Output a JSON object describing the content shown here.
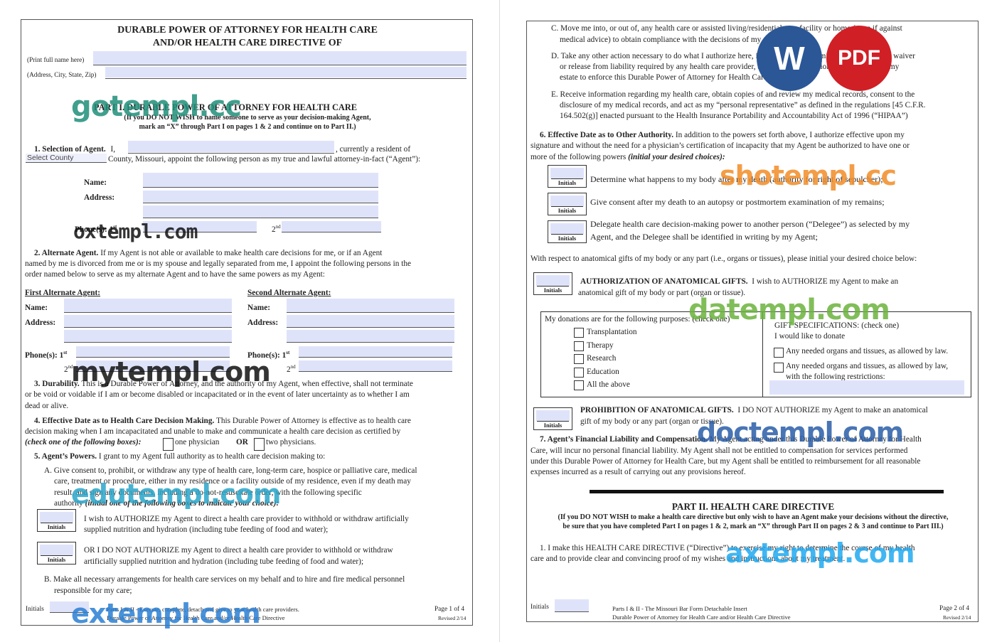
{
  "p1": {
    "title1": "DURABLE POWER OF ATTORNEY FOR HEALTH CARE",
    "title2": "AND/OR HEALTH CARE DIRECTIVE OF",
    "print_name": "(Print full name here)",
    "address_city": "(Address, City, State, Zip)",
    "part1_title": "PART I.   DURABLE POWER OF ATTORNEY FOR HEALTH CARE",
    "part1_sub1": "(If you DO NOT WISH to name someone to serve as your decision-making Agent,",
    "part1_sub2": "mark an “X” through Part I on pages 1 & 2 and continue on to Part II.)",
    "s1_head": "1. Selection of Agent.",
    "s1_i": "I,",
    "s1_resident": ", currently a resident of",
    "county_select": "Select County",
    "s1_county": "County, Missouri, appoint the following person as my true and lawful attorney-in-fact (“Agent”):",
    "name_label": "Name:",
    "address_label": "Address:",
    "phones_label": "Phone(s): 1",
    "second": "2",
    "st": "st",
    "nd": "nd",
    "s2_head": "2. Alternate Agent.",
    "s2_l1": "If my Agent is not able or available to make health care decisions for me, or if an Agent",
    "s2_l2": "named by me is divorced from me or is my spouse and legally separated from me, I appoint the following persons in the",
    "s2_l3": "order named below to serve as my alternate Agent and to have the same powers as my Agent:",
    "first_alt": "First Alternate Agent:",
    "second_alt": "Second Alternate Agent:",
    "s3_head": "3. Durability.",
    "s3_l1": "This is a Durable Power of Attorney, and the authority of my Agent, when effective, shall not terminate",
    "s3_l2": "or be void or voidable if I am or become disabled or incapacitated or in the event of later uncertainty as to whether I am",
    "s3_l3": "dead or alive.",
    "s4_head": "4. Effective Date as to Health Care Decision Making.",
    "s4_l1": "This Durable Power of Attorney is effective as to health care",
    "s4_l2": "decision making when I am incapacitated and unable to make and communicate a health care decision as certified by",
    "s4_check": "(check one of the following boxes):",
    "one_physician": "one physician",
    "or": "OR",
    "two_physicians": "two physicians.",
    "s5_head": "5. Agent’s Powers.",
    "s5_l1": "I grant to my Agent full authority as to health care decision making to:",
    "s5a_l1": "A.  Give consent to, prohibit, or withdraw any type of health care, long-term care, hospice or palliative care, medical",
    "s5a_l2": "care, treatment or procedure, either in my residence or a facility outside of my residence, even if my death may",
    "s5a_l3": "result, and sign any documents, including a do-not-resuscitate order, with the following specific",
    "s5a_l4a": "authority",
    "s5a_l4b": "(initial one of the following boxes to indicate your choice):",
    "authorize_l1": "I wish to AUTHORIZE my Agent to direct a health care provider to withhold or withdraw artificially",
    "authorize_l2": "supplied nutrition and hydration (including tube feeding of food and water);",
    "notauth_l1": "OR I DO NOT AUTHORIZE my Agent to direct a health care provider to withhold or withdraw",
    "notauth_l2": "artificially supplied nutrition and hydration (including tube feeding of food and water);",
    "s5b_l1": "B.  Make all necessary arrangements for health care services on my behalf and to hire and fire medical personnel",
    "s5b_l2": "responsible for my care;",
    "initials_label": "Initials",
    "footer_l1": "Parts I & II - Execute, complete, detach and give to your health care providers.",
    "footer_l2": "Durable Power of Attorney for Health Care and/or Health Care Directive",
    "page": "Page 1 of 4",
    "revised": "Revised 2/14"
  },
  "p2": {
    "c_l1": "C. Move me into, or out of, any health care or assisted living/residential care facility or home (even if against",
    "c_l2": "medical advice) to obtain compliance with the decisions of my Agent;",
    "d_l1": "D. Take any other action necessary to do what I authorize here, including (but not limited to) granting any waiver",
    "d_l2": "or release from liability required by any health care provider, and taking legal action at the expense of my",
    "d_l3": "estate to enforce this Durable Power of Attorney for Health Care;",
    "e_l1": "E.  Receive information regarding my health care, obtain copies of and review my medical records, consent to the",
    "e_l2": "disclosure of my medical records, and act as my “personal representative” as defined in the regulations [45 C.F.R.",
    "e_l3": "164.502(g)] enacted pursuant to the Health Insurance Portability and Accountability Act of 1996 (“HIPAA”)",
    "s6_head": "6. Effective Date as to Other Authority.",
    "s6_l1": "In addition to the powers set forth above, I authorize effective upon my",
    "s6_l2": "signature and without the need for a physician’s certification of incapacity that my Agent be authorized to have one or",
    "s6_l3a": "more of the following powers",
    "s6_l3b": "(initial your desired choices):",
    "determine": "Determine what happens to my body after my death (authority for right of sepulcher);",
    "autopsy": "Give consent after my death to an autopsy or postmortem examination of my remains;",
    "delegate_l1": "Delegate health care decision-making power to another person (“Delegee”) as selected by my",
    "delegate_l2": "Agent, and the Delegee shall be identified in writing by my Agent;",
    "respect": "With respect to anatomical gifts of my body or any part (i.e., organs or tissues), please initial your desired choice below:",
    "auth_gifts_head": "AUTHORIZATION OF ANATOMICAL GIFTS.",
    "auth_gifts_l1": "I wish to AUTHORIZE my Agent to make an",
    "auth_gifts_l2": "anatomical gift of my body or part (organ or tissue).",
    "donations_head": "My donations are for the following purposes: (check one)",
    "purposes": [
      "Transplantation",
      "Therapy",
      "Research",
      "Education",
      "All the above"
    ],
    "gift_spec": "GIFT SPECIFICATIONS: (check one)",
    "gift_donate": "I would like to donate",
    "any_needed1": "Any needed organs and tissues, as allowed by law.",
    "any_needed2_l1": "Any needed organs and tissues, as allowed by law,",
    "any_needed2_l2": "with the following restrictions:",
    "prohib_head": "PROHIBITION OF ANATOMICAL GIFTS.",
    "prohib_l1": "I DO NOT AUTHORIZE my Agent to make an anatomical",
    "prohib_l2": "gift of my body or any part (organ or tissue).",
    "s7_head": "7. Agent’s Financial Liability and Compensation.",
    "s7_l1": "My Agent acting under this Durable Power of Attorney for Health",
    "s7_l2": "Care, will incur no personal financial liability.  My Agent shall not be entitled to compensation for services performed",
    "s7_l3": "under this Durable Power of Attorney for Health Care, but my Agent shall be entitled to reimbursement for all reasonable",
    "s7_l4": "expenses incurred as a result of carrying out any provisions hereof.",
    "part2_title": "PART II.  HEALTH CARE DIRECTIVE",
    "part2_sub1": "(If you DO NOT WISH to make a health care directive but only wish to have an Agent make your decisions without the directive,",
    "part2_sub2": "be sure that you have completed Part I on pages 1 & 2, mark an “X” through Part II on pages 2 & 3 and continue to Part III.)",
    "d1_l1": "1. I make this HEALTH CARE DIRECTIVE (“Directive”) to exercise my right to determine the course of my health",
    "d1_l2": "care and to provide clear and convincing proof of my wishes and instructions about my treatment.",
    "initials_label": "Initials",
    "footer_l1": "Parts I & II - The Missouri Bar Form Detachable Insert",
    "footer_l2": "Durable Power of Attorney for Health Care and/or Health Care Directive",
    "page": "Page 2 of 4",
    "revised": "Revised 2/14"
  },
  "initials_box": "Initials",
  "badges": {
    "word": "W",
    "pdf": "PDF"
  },
  "watermarks": [
    "gotempl.cc",
    "oxtempl.com",
    "mytempl.com",
    "edutempl.com",
    "extempl.com",
    "shotempl.cc",
    "datempl.com",
    "doctempl.com",
    "axtempl.com"
  ],
  "colors": {
    "field": "#dfe3fa",
    "word_badge": "#2b5797",
    "pdf_badge": "#d11f26"
  }
}
